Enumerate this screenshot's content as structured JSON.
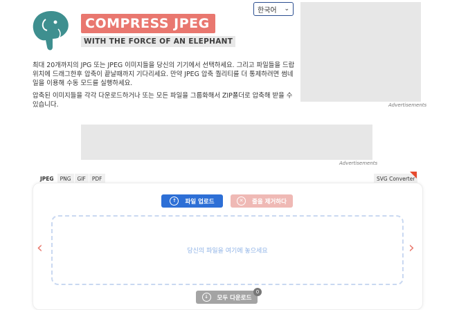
{
  "header": {
    "brand_title": "COMPRESS JPEG",
    "brand_tagline": "WITH THE FORCE OF AN ELEPHANT",
    "language": "한국어",
    "logo_icon": "elephant-logo-icon"
  },
  "ads": {
    "right_label": "Advertisements",
    "middle_label": "Advertisements"
  },
  "intro": {
    "paragraph1": "최대 20개까지의 JPG 또는 JPEG 이미지들을 당신의 기기에서 선택하세요. 그리고 파일들을 드랍 위치에 드래그한후 압축이 끝날때까지 기다리세요. 만약 JPEG 압축 퀄리티를 더 통제하려면 썸네일을 이용해 수동 모드를 실행하세요.",
    "paragraph2": "압축된 이미지들을 각각 다운로드하거나 또는 모든 파일을 그룹화해서 ZIP폴더로 압축해 받을 수 있습니다."
  },
  "tabs": [
    "JPEG",
    "PNG",
    "GIF",
    "PDF"
  ],
  "active_tab": "JPEG",
  "svg_converter": "SVG Converter",
  "toolbar": {
    "upload_label": "파일 업로드",
    "clear_label": "줄을 제거하다"
  },
  "dropzone": {
    "text": "당신의 파일을 여기에 놓으세요"
  },
  "download": {
    "label": "모두 다운로드",
    "count": "0"
  },
  "colors": {
    "accent": "#2d6fd6",
    "brand": "#e9776f",
    "clear_button": "#efb9b5",
    "disabled": "#a4a4a4"
  }
}
